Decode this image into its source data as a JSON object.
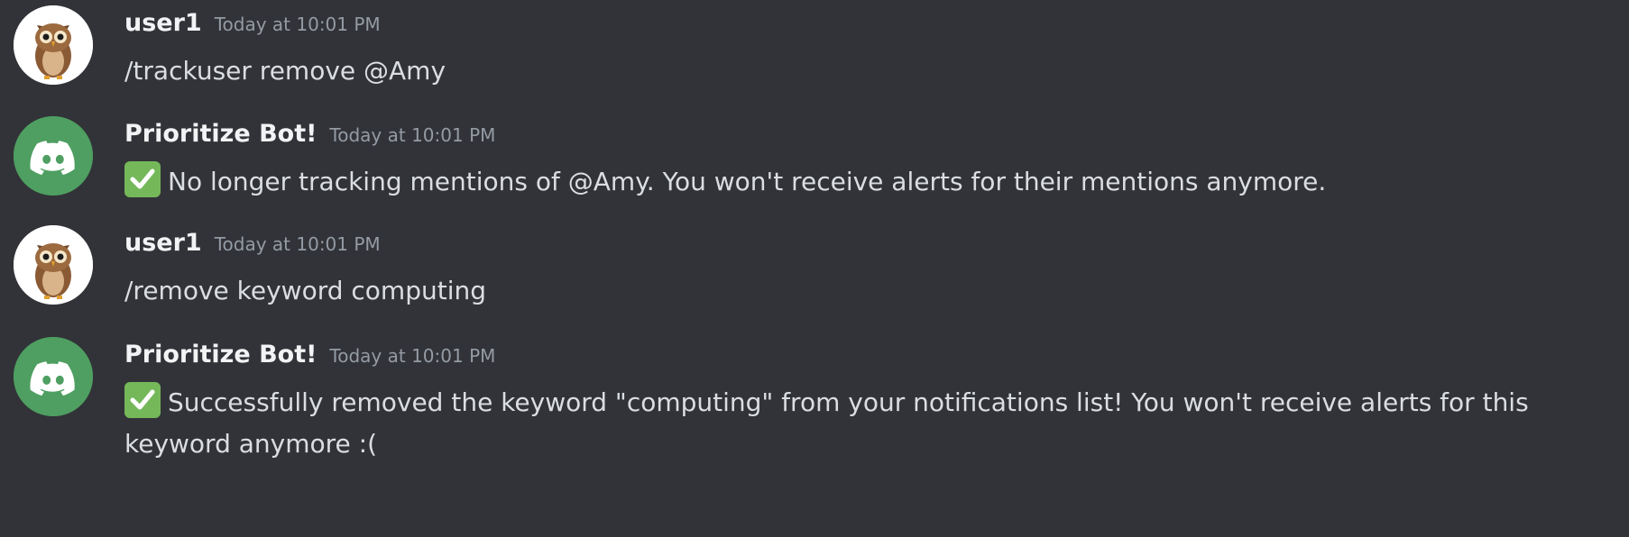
{
  "messages": [
    {
      "author": "user1",
      "timestamp": "Today at 10:01 PM",
      "text": "/trackuser remove @Amy",
      "avatar_icon": "owl-avatar-icon"
    },
    {
      "author": "Prioritize Bot!",
      "timestamp": "Today at 10:01 PM",
      "emoji": "white-check-mark-icon",
      "text": "No longer tracking mentions of @Amy. You won't receive alerts for their mentions anymore.",
      "avatar_icon": "discord-logo-icon",
      "avatar_color": "#4e9f61"
    },
    {
      "author": "user1",
      "timestamp": "Today at 10:01 PM",
      "text": "/remove keyword computing",
      "avatar_icon": "owl-avatar-icon"
    },
    {
      "author": "Prioritize Bot!",
      "timestamp": "Today at 10:01 PM",
      "emoji": "white-check-mark-icon",
      "text": "Successfully removed the keyword \"computing\" from your notifications list! You won't receive alerts for this keyword anymore :(",
      "avatar_icon": "discord-logo-icon",
      "avatar_color": "#4e9f61"
    }
  ],
  "colors": {
    "background": "#323338",
    "username": "#f2f3f5",
    "timestamp": "#949ba4",
    "message_text": "#dbdee1",
    "check_emoji": "#75b85a"
  }
}
